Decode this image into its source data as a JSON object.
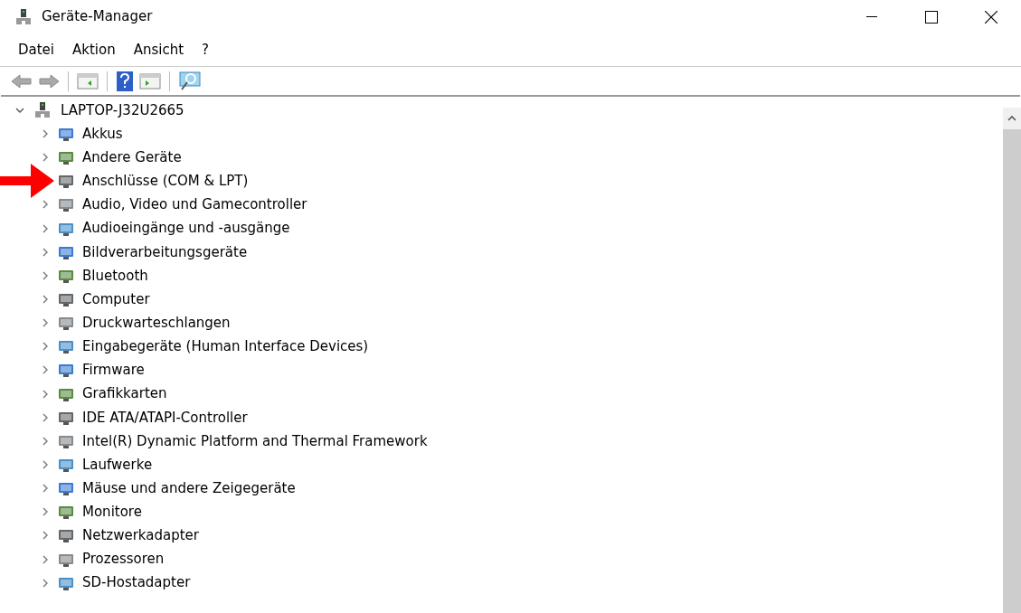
{
  "window": {
    "title": "Geräte-Manager"
  },
  "menu": [
    "Datei",
    "Aktion",
    "Ansicht",
    "?"
  ],
  "tree": {
    "label": "LAPTOP-J32U2665",
    "expanded": true,
    "children": [
      {
        "label": "Akkus",
        "highlighted": false
      },
      {
        "label": "Andere Geräte",
        "highlighted": false
      },
      {
        "label": "Anschlüsse (COM & LPT)",
        "highlighted": true
      },
      {
        "label": "Audio, Video und Gamecontroller",
        "highlighted": false
      },
      {
        "label": "Audioeingänge und -ausgänge",
        "highlighted": false
      },
      {
        "label": "Bildverarbeitungsgeräte",
        "highlighted": false
      },
      {
        "label": "Bluetooth",
        "highlighted": false
      },
      {
        "label": "Computer",
        "highlighted": false
      },
      {
        "label": "Druckwarteschlangen",
        "highlighted": false
      },
      {
        "label": "Eingabegeräte (Human Interface Devices)",
        "highlighted": false
      },
      {
        "label": "Firmware",
        "highlighted": false
      },
      {
        "label": "Grafikkarten",
        "highlighted": false
      },
      {
        "label": "IDE ATA/ATAPI-Controller",
        "highlighted": false
      },
      {
        "label": "Intel(R) Dynamic Platform and Thermal Framework",
        "highlighted": false
      },
      {
        "label": "Laufwerke",
        "highlighted": false
      },
      {
        "label": "Mäuse und andere Zeigegeräte",
        "highlighted": false
      },
      {
        "label": "Monitore",
        "highlighted": false
      },
      {
        "label": "Netzwerkadapter",
        "highlighted": false
      },
      {
        "label": "Prozessoren",
        "highlighted": false
      },
      {
        "label": "SD-Hostadapter",
        "highlighted": false
      }
    ]
  }
}
